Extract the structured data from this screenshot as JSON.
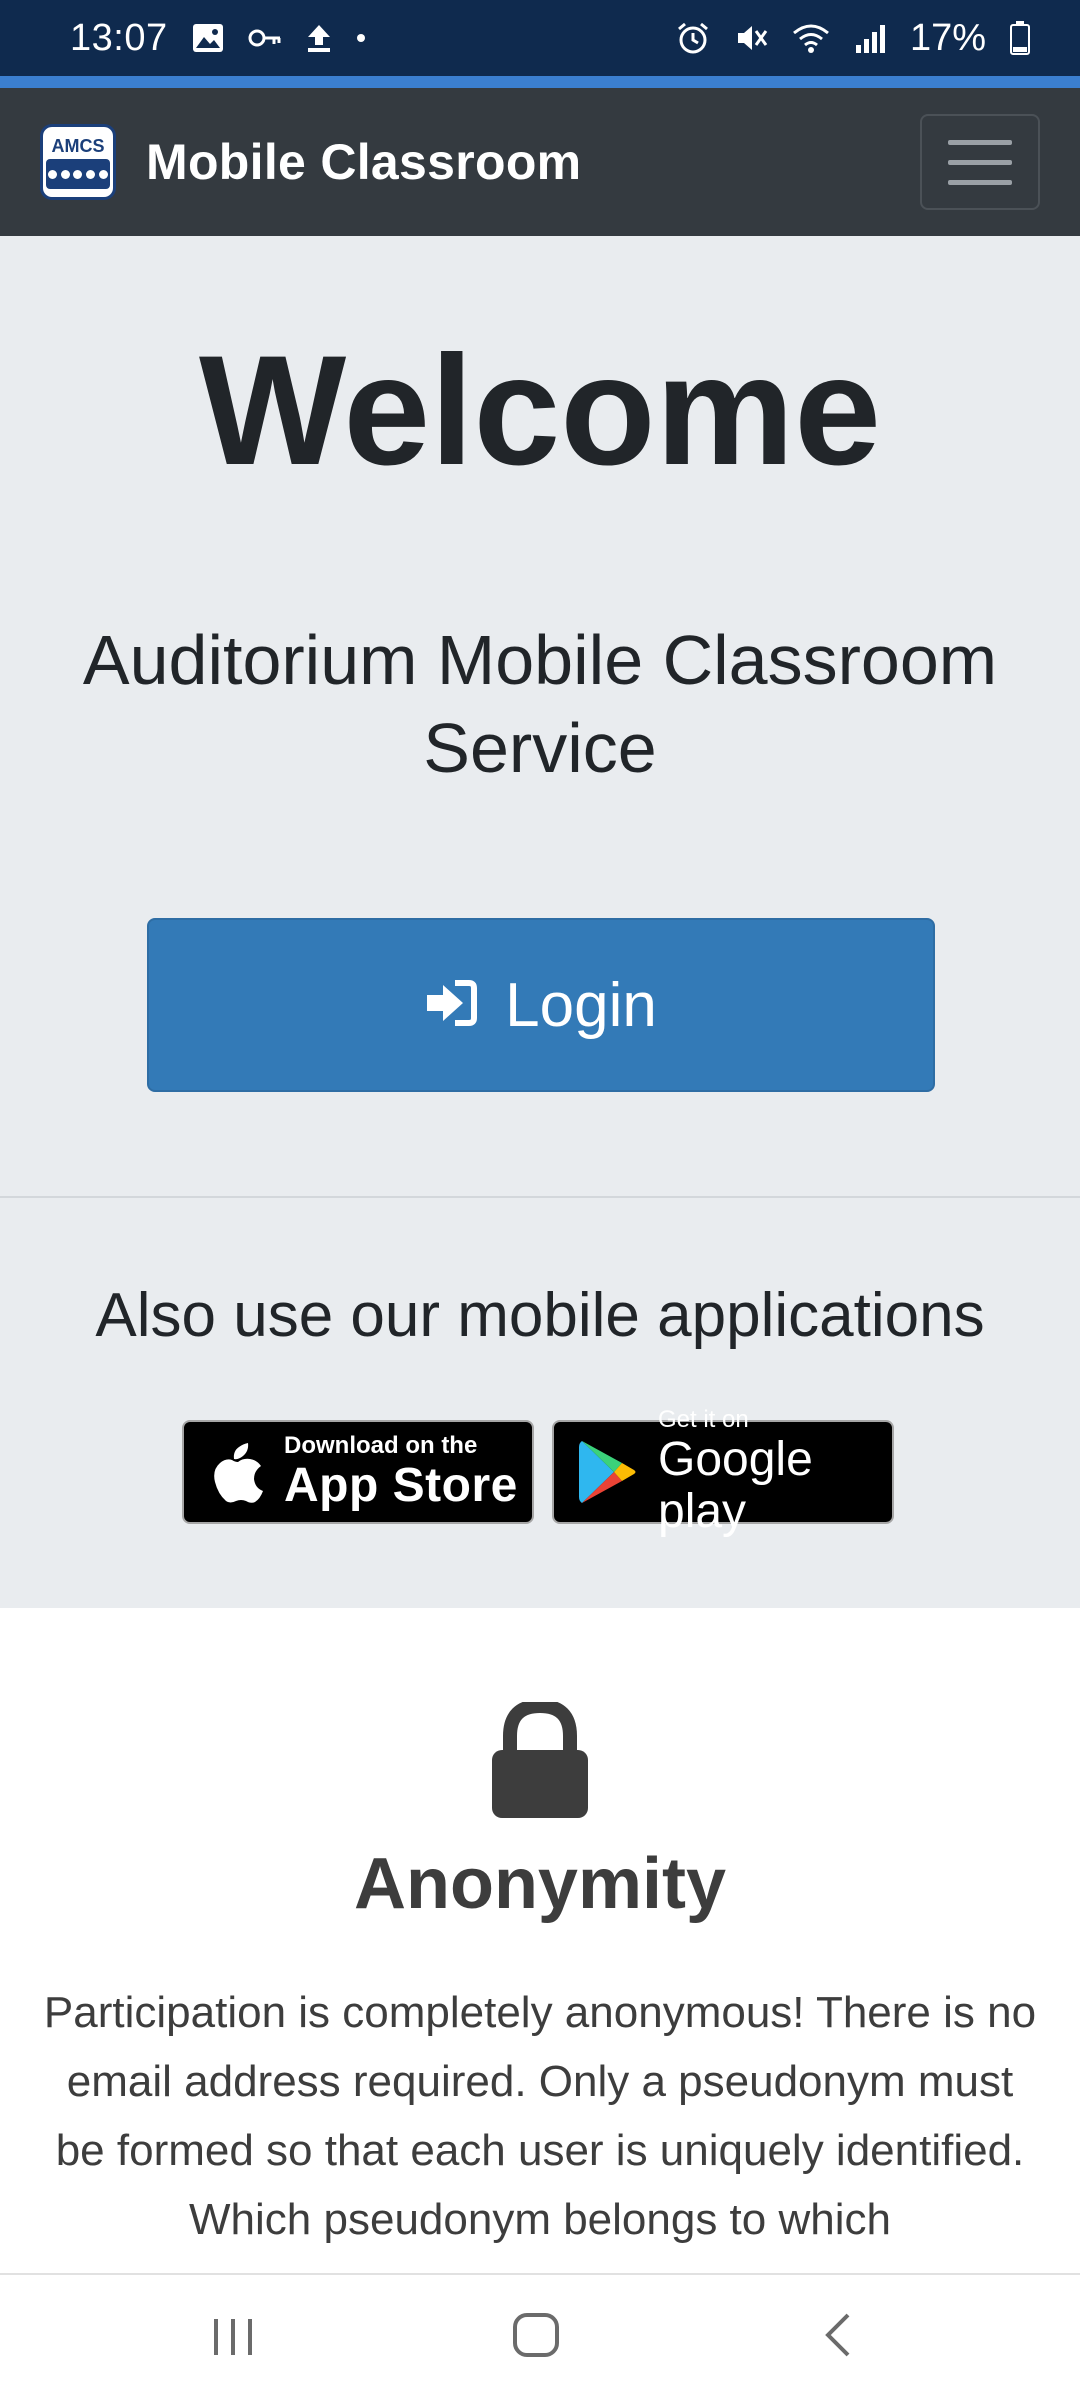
{
  "status_bar": {
    "time": "13:07",
    "battery": "17%"
  },
  "navbar": {
    "brand_logo_text": "AMCS",
    "brand_name": "Mobile Classroom"
  },
  "hero": {
    "title": "Welcome",
    "subtitle": "Auditorium Mobile Classroom Service",
    "login_label": "Login"
  },
  "apps": {
    "title": "Also use our mobile applications",
    "appstore": {
      "small": "Download on the",
      "big": "App Store"
    },
    "googleplay": {
      "small": "Get it on",
      "big": "Google play"
    }
  },
  "anonymity": {
    "title": "Anonymity",
    "text": "Participation is completely anonymous! There is no email address required. Only a pseudonym must be formed so that each user is uniquely identified. Which pseudonym belongs to which"
  },
  "colors": {
    "status_bg": "#0f2a4e",
    "accent": "#3b7fd0",
    "navbar_bg": "#343a40",
    "hero_bg": "#e9ecef",
    "primary_button": "#337ab7"
  },
  "icons": {
    "status_left": [
      "image-icon",
      "key-icon",
      "upload-icon",
      "dot-icon"
    ],
    "status_right": [
      "alarm-icon",
      "mute-icon",
      "wifi-icon",
      "signal-icon",
      "battery-icon"
    ],
    "login": "sign-in-icon",
    "section": "lock-icon",
    "system_nav": [
      "recent-apps-icon",
      "home-icon",
      "back-icon"
    ]
  }
}
